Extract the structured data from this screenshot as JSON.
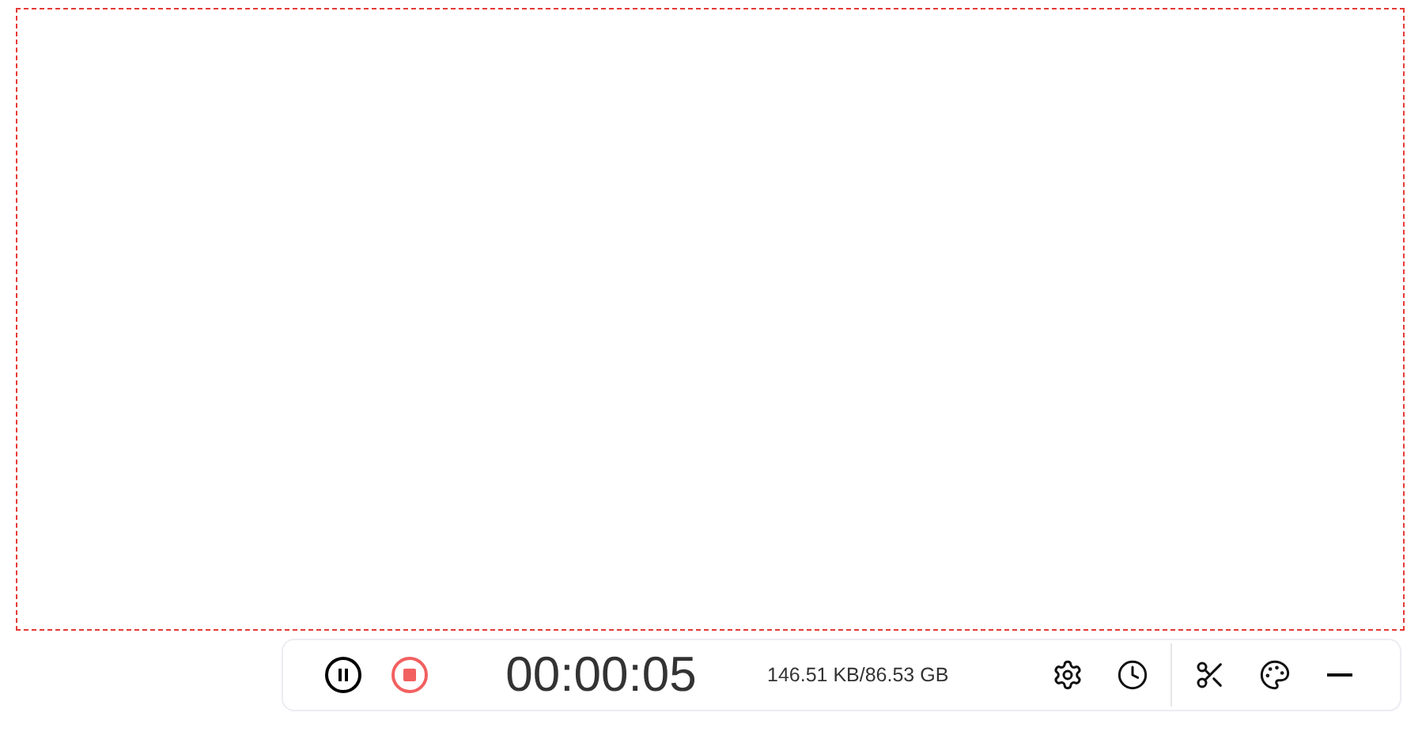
{
  "capture_region": {
    "kind": "dashed"
  },
  "toolbar": {
    "controls": [
      {
        "kind": "pause"
      },
      {
        "kind": "stop"
      }
    ],
    "timer": "00:00:05",
    "file_size": "146.51 KB/86.53 GB",
    "tools": [
      {
        "kind": "settings"
      },
      {
        "kind": "history"
      }
    ],
    "edit_tools": [
      {
        "kind": "cut"
      },
      {
        "kind": "theme"
      },
      {
        "kind": "minimize"
      }
    ]
  }
}
